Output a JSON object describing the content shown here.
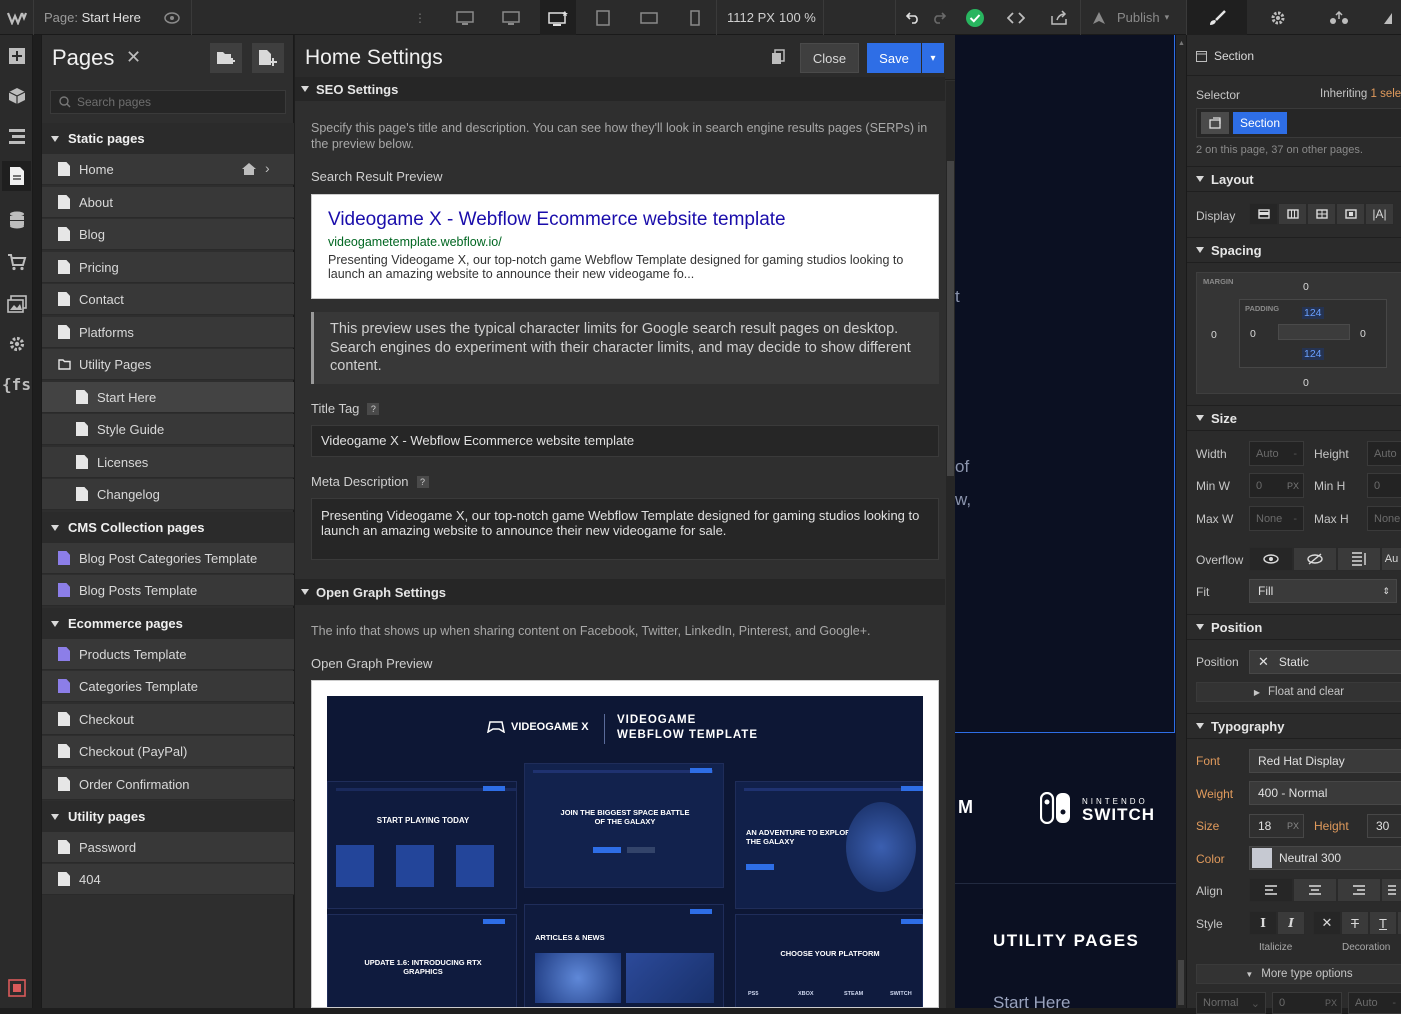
{
  "topbar": {
    "page_label": "Page:",
    "page_name": "Start Here",
    "canvas_width": "1112 PX",
    "zoom": "100 %",
    "publish_label": "Publish"
  },
  "pages_panel": {
    "title": "Pages",
    "search_placeholder": "Search pages",
    "sections": [
      {
        "label": "Static pages",
        "items": [
          "Home",
          "About",
          "Blog",
          "Pricing",
          "Contact",
          "Platforms"
        ]
      },
      {
        "label": "Utility Pages",
        "items": [
          "Start Here",
          "Style Guide",
          "Licenses",
          "Changelog"
        ]
      },
      {
        "label": "CMS Collection pages",
        "items": [
          "Blog Post Categories Template",
          "Blog Posts Template"
        ]
      },
      {
        "label": "Ecommerce pages",
        "items": [
          "Products Template",
          "Categories Template",
          "Checkout",
          "Checkout (PayPal)",
          "Order Confirmation"
        ]
      },
      {
        "label": "Utility pages",
        "items": [
          "Password",
          "404"
        ]
      }
    ]
  },
  "settings": {
    "title": "Home Settings",
    "close_label": "Close",
    "save_label": "Save",
    "seo_header": "SEO Settings",
    "seo_intro": "Specify this page's title and description. You can see how they'll look in search engine results pages (SERPs) in the preview below.",
    "search_preview_label": "Search Result Preview",
    "serp_title": "Videogame X - Webflow Ecommerce website template",
    "serp_url": "videogametemplate.webflow.io/",
    "serp_desc": "Presenting Videogame X, our top-notch game Webflow Template designed for gaming studios looking to launch an amazing website to announce their new videogame fo...",
    "preview_note": "This preview uses the typical character limits for Google search result pages on desktop. Search engines do experiment with their character limits, and may decide to show different content.",
    "title_tag_label": "Title Tag",
    "title_tag_value": "Videogame X - Webflow Ecommerce website template",
    "meta_desc_label": "Meta Description",
    "meta_desc_value": "Presenting Videogame X, our top-notch game Webflow Template designed for gaming studios looking to launch an amazing website to announce their new videogame for sale.",
    "og_header": "Open Graph Settings",
    "og_intro": "The info that shows up when sharing content on Facebook, Twitter, LinkedIn, Pinterest, and Google+.",
    "og_preview_label": "Open Graph Preview",
    "og_image": {
      "brand": "VIDEOGAME X",
      "headline_1": "VIDEOGAME",
      "headline_2": "WEBFLOW TEMPLATE",
      "card_1": "START PLAYING TODAY",
      "card_2": "JOIN THE BIGGEST SPACE BATTLE OF THE GALAXY",
      "card_3": "AN ADVENTURE TO EXPLORE THE GALAXY",
      "card_4": "UPDATE 1.6: INTRODUCING RTX GRAPHICS",
      "card_5": "ARTICLES & NEWS",
      "card_6": "CHOOSE YOUR PLATFORM",
      "platforms": [
        "PS5",
        "XBOX",
        "STEAM",
        "SWITCH"
      ]
    }
  },
  "canvas": {
    "letter_t": "t",
    "text_of": "of",
    "text_w": "w,",
    "logo_m": "M",
    "switch_top": "NINTENDO",
    "switch_bottom": "SWITCH",
    "utility_heading": "UTILITY PAGES",
    "start_here": "Start Here"
  },
  "style_panel": {
    "section_label": "Section",
    "selector_label": "Selector",
    "inheriting": "Inheriting",
    "inheriting_count": "1 sele",
    "selector_chip": "Section",
    "selector_info": "2 on this page, 37 on other pages.",
    "layout_header": "Layout",
    "display_label": "Display",
    "spacing_header": "Spacing",
    "margin_label": "MARGIN",
    "padding_label": "PADDING",
    "margin_top": "0",
    "margin_left": "0",
    "margin_right": "0",
    "margin_bottom": "0",
    "padding_top": "124",
    "padding_left": "0",
    "padding_right": "0",
    "padding_bottom": "124",
    "size_header": "Size",
    "width_label": "Width",
    "width_val": "Auto",
    "height_label": "Height",
    "height_val": "Auto",
    "minw_label": "Min W",
    "minw_val": "0",
    "minw_unit": "PX",
    "minh_label": "Min H",
    "minh_val": "0",
    "maxw_label": "Max W",
    "maxw_val": "None",
    "maxh_label": "Max H",
    "maxh_val": "None",
    "overflow_label": "Overflow",
    "overflow_auto": "Au",
    "fit_label": "Fit",
    "fit_val": "Fill",
    "position_header": "Position",
    "position_label": "Position",
    "position_val": "Static",
    "float_label": "Float and clear",
    "typography_header": "Typography",
    "font_label": "Font",
    "font_val": "Red Hat Display",
    "weight_label": "Weight",
    "weight_val": "400 - Normal",
    "size_label": "Size",
    "size_val": "18",
    "size_unit": "PX",
    "lh_label": "Height",
    "lh_val": "30",
    "color_label": "Color",
    "color_val": "Neutral 300",
    "align_label": "Align",
    "style_label": "Style",
    "italicize_label": "Italicize",
    "decoration_label": "Decoration",
    "more_type": "More type options",
    "bottom_1": "Normal",
    "bottom_2": "0",
    "bottom_2_unit": "PX",
    "bottom_3": "Auto"
  },
  "colors": {
    "accent": "#2e6ee6",
    "serp_title": "#1a0dab",
    "serp_url": "#006621",
    "property_set": "#e09a5c",
    "cms_page": "#8c7ee8"
  }
}
